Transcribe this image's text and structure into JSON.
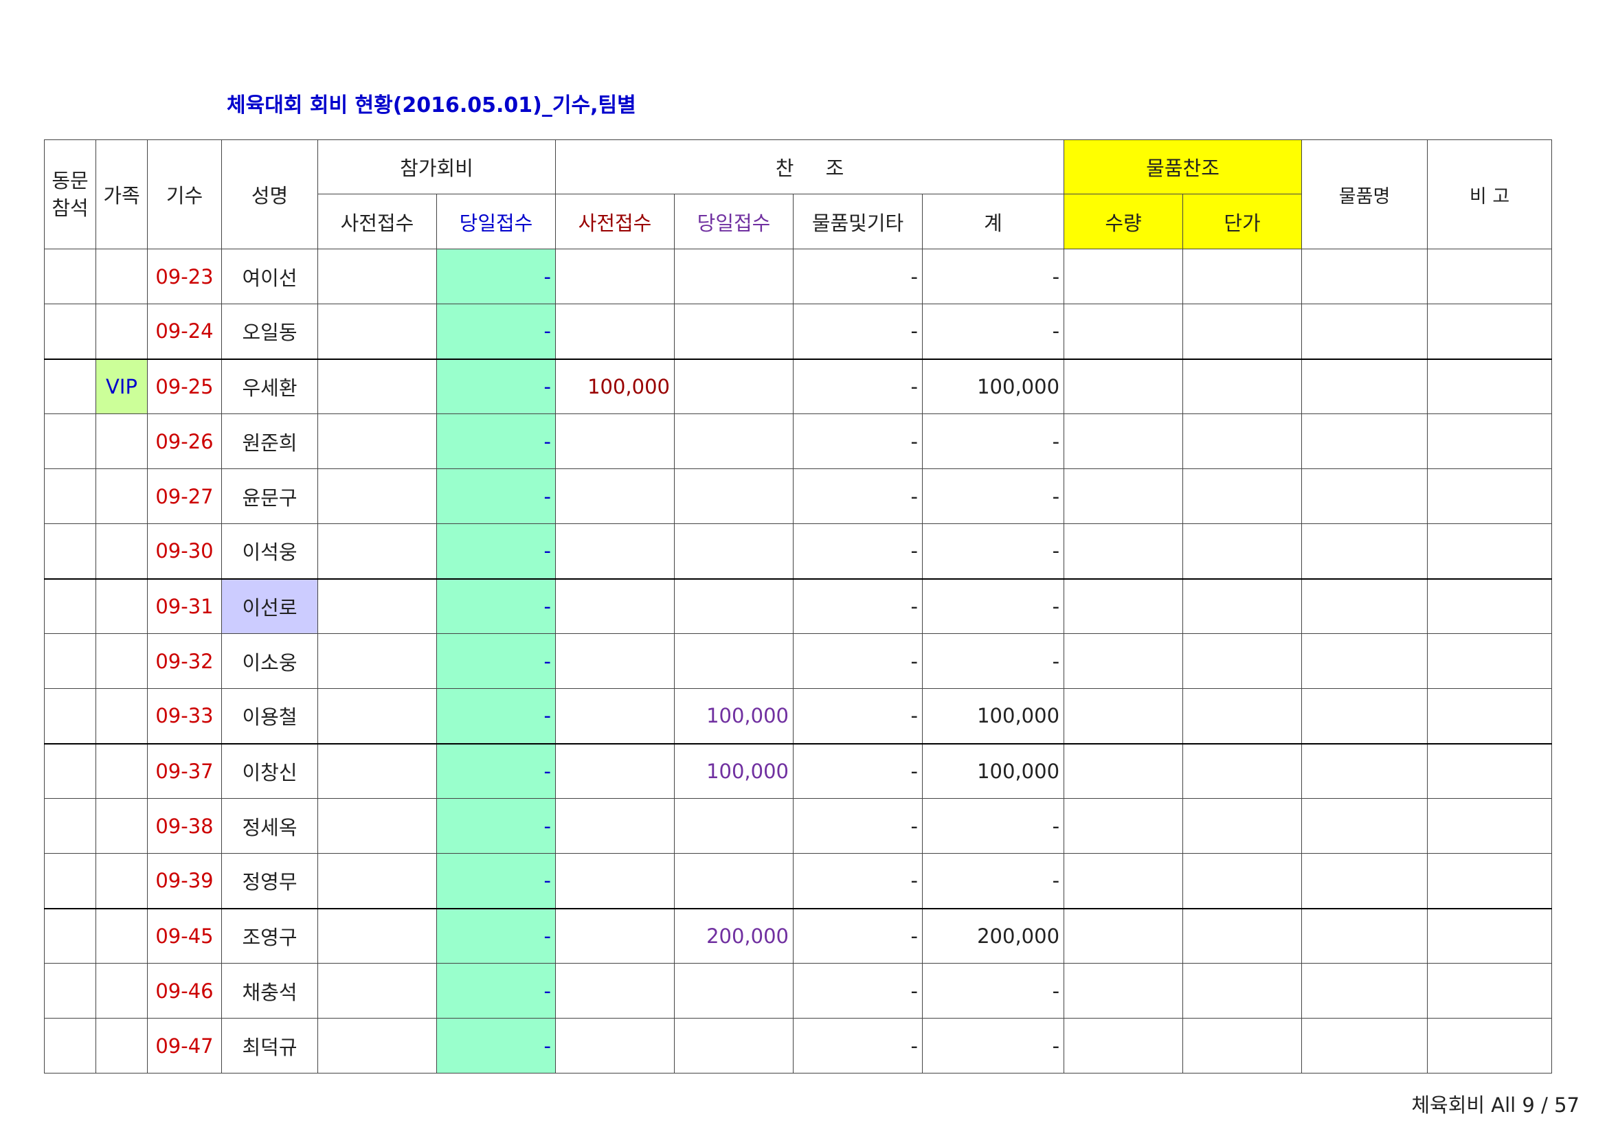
{
  "title": "체육대회 회비 현황(2016.05.01)_기수,팀별",
  "headers": {
    "attend": "동문\n참석",
    "family": "가족",
    "cohort": "기수",
    "name": "성명",
    "fee": "참가회비",
    "fee_pre": "사전접수",
    "fee_day": "당일접수",
    "sponsor": "찬     조",
    "sp_pre": "사전접수",
    "sp_day": "당일접수",
    "sp_goods": "물품및기타",
    "sp_total": "계",
    "goods_sponsor": "물품찬조",
    "qty": "수량",
    "price": "단가",
    "goods_name": "물품명",
    "note": "비 고"
  },
  "rows": [
    {
      "family": "",
      "cohort": "09-23",
      "name": "여이선",
      "fee_day": "-",
      "sp_pre": "",
      "sp_day": "",
      "sp_goods": "-",
      "sp_total": "-"
    },
    {
      "family": "",
      "cohort": "09-24",
      "name": "오일동",
      "fee_day": "-",
      "sp_pre": "",
      "sp_day": "",
      "sp_goods": "-",
      "sp_total": "-"
    },
    {
      "family": "VIP",
      "cohort": "09-25",
      "name": "우세환",
      "fee_day": "-",
      "sp_pre": "100,000",
      "sp_day": "",
      "sp_goods": "-",
      "sp_total": "100,000"
    },
    {
      "family": "",
      "cohort": "09-26",
      "name": "원준희",
      "fee_day": "-",
      "sp_pre": "",
      "sp_day": "",
      "sp_goods": "-",
      "sp_total": "-"
    },
    {
      "family": "",
      "cohort": "09-27",
      "name": "윤문구",
      "fee_day": "-",
      "sp_pre": "",
      "sp_day": "",
      "sp_goods": "-",
      "sp_total": "-"
    },
    {
      "family": "",
      "cohort": "09-30",
      "name": "이석웅",
      "fee_day": "-",
      "sp_pre": "",
      "sp_day": "",
      "sp_goods": "-",
      "sp_total": "-"
    },
    {
      "family": "",
      "cohort": "09-31",
      "name": "이선로",
      "fee_day": "-",
      "sp_pre": "",
      "sp_day": "",
      "sp_goods": "-",
      "sp_total": "-"
    },
    {
      "family": "",
      "cohort": "09-32",
      "name": "이소웅",
      "fee_day": "-",
      "sp_pre": "",
      "sp_day": "",
      "sp_goods": "-",
      "sp_total": "-"
    },
    {
      "family": "",
      "cohort": "09-33",
      "name": "이용철",
      "fee_day": "-",
      "sp_pre": "",
      "sp_day": "100,000",
      "sp_goods": "-",
      "sp_total": "100,000"
    },
    {
      "family": "",
      "cohort": "09-37",
      "name": "이창신",
      "fee_day": "-",
      "sp_pre": "",
      "sp_day": "100,000",
      "sp_goods": "-",
      "sp_total": "100,000"
    },
    {
      "family": "",
      "cohort": "09-38",
      "name": "정세옥",
      "fee_day": "-",
      "sp_pre": "",
      "sp_day": "",
      "sp_goods": "-",
      "sp_total": "-"
    },
    {
      "family": "",
      "cohort": "09-39",
      "name": "정영무",
      "fee_day": "-",
      "sp_pre": "",
      "sp_day": "",
      "sp_goods": "-",
      "sp_total": "-"
    },
    {
      "family": "",
      "cohort": "09-45",
      "name": "조영구",
      "fee_day": "-",
      "sp_pre": "",
      "sp_day": "200,000",
      "sp_goods": "-",
      "sp_total": "200,000"
    },
    {
      "family": "",
      "cohort": "09-46",
      "name": "채충석",
      "fee_day": "-",
      "sp_pre": "",
      "sp_day": "",
      "sp_goods": "-",
      "sp_total": "-"
    },
    {
      "family": "",
      "cohort": "09-47",
      "name": "최덕규",
      "fee_day": "-",
      "sp_pre": "",
      "sp_day": "",
      "sp_goods": "-",
      "sp_total": "-"
    }
  ],
  "footer": "체육회비 All 9 / 57",
  "colors": {
    "title": "#0000cc",
    "fee_day_bg": "#99ffcc",
    "goods_header_bg": "#ffff00",
    "vip_bg": "#ccff99",
    "name_highlight_bg": "#ccccff",
    "cohort_text": "#cc0000",
    "sp_pre_text": "#990000",
    "sp_day_text": "#7030a0"
  }
}
